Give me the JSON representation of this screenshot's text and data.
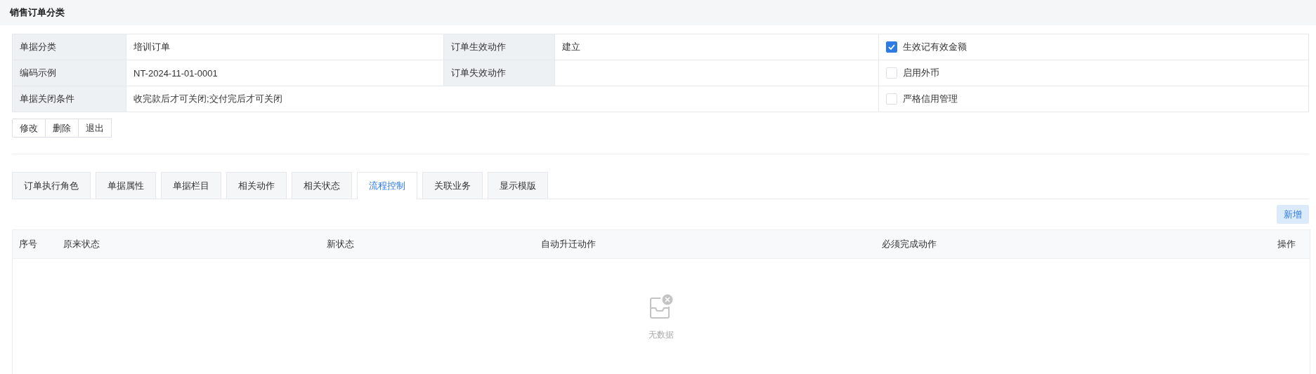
{
  "header": {
    "title": "销售订单分类"
  },
  "info": {
    "rows": [
      {
        "label_1": "单据分类",
        "value_1": "培训订单",
        "label_2": "订单生效动作",
        "value_2": "建立",
        "option": {
          "label": "生效记有效金额",
          "checked": true
        }
      },
      {
        "label_1": "编码示例",
        "value_1": "NT-2024-11-01-0001",
        "label_2": "订单失效动作",
        "value_2": "",
        "option": {
          "label": "启用外币",
          "checked": false
        }
      },
      {
        "label_1": "单据关闭条件",
        "value_1": "收完款后才可关闭;交付完后才可关闭",
        "option": {
          "label": "严格信用管理",
          "checked": false
        }
      }
    ]
  },
  "actions": [
    "修改",
    "删除",
    "退出"
  ],
  "tabs": [
    {
      "label": "订单执行角色",
      "selected": false
    },
    {
      "label": "单据属性",
      "selected": false
    },
    {
      "label": "单据栏目",
      "selected": false
    },
    {
      "label": "相关动作",
      "selected": false
    },
    {
      "label": "相关状态",
      "selected": false
    },
    {
      "label": "流程控制",
      "selected": true
    },
    {
      "label": "关联业务",
      "selected": false
    },
    {
      "label": "显示模版",
      "selected": false
    }
  ],
  "add_button": "新增",
  "table": {
    "columns": [
      "序号",
      "原来状态",
      "新状态",
      "自动升迁动作",
      "必须完成动作",
      "操作"
    ],
    "empty_text": "无数据"
  }
}
